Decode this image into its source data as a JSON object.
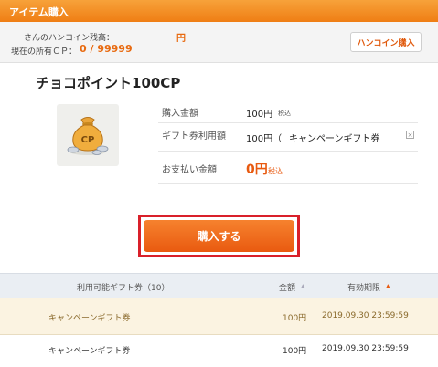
{
  "header": {
    "title": "アイテム購入"
  },
  "balance": {
    "coin_label": "さんのハンコイン残高：",
    "coin_value": "円",
    "cp_label": "現在の所有ＣＰ：",
    "cp_value": "0 / 99999",
    "coin_button": "ハンコイン購入"
  },
  "product": {
    "title": "チョコポイント100CP",
    "price_label": "購入金額",
    "price_value": "100円",
    "tax_label": "税込",
    "gift_label": "ギフト券利用額",
    "gift_value": "100円（",
    "gift_name": "キャンペーンギフト券",
    "gift_remove": "×",
    "pay_label": "お支払い金額",
    "pay_value": "0円",
    "pay_tax": "税込"
  },
  "buy_button": "購入する",
  "table": {
    "col_name": "利用可能ギフト券（10）",
    "col_amount": "金額",
    "col_amount_sort": "▲",
    "col_expiry": "有効期限",
    "col_expiry_sort": "▲",
    "rows": [
      {
        "name": "キャンペーンギフト券",
        "amount": "100円",
        "expiry": "2019.09.30 23:59:59"
      },
      {
        "name": "キャンペーンギフト券",
        "amount": "100円",
        "expiry": "2019.09.30 23:59:59"
      }
    ]
  },
  "colors": {
    "accent": "#ef7e14",
    "price": "#e85a10",
    "highlight": "#d9202a"
  }
}
